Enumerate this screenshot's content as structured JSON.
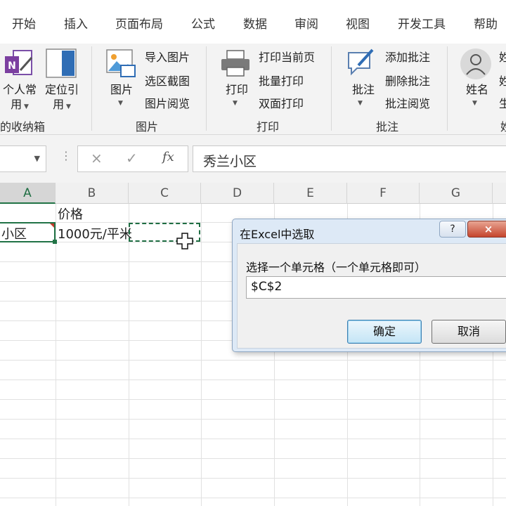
{
  "menu_tabs": [
    "开始",
    "插入",
    "页面布局",
    "公式",
    "数据",
    "审阅",
    "视图",
    "开发工具",
    "帮助"
  ],
  "ribbon": {
    "favorites": {
      "btn1_line1": "个人常",
      "btn1_line2": "用",
      "btn2_line1": "定位引",
      "btn2_line2": "用",
      "group_label": "的收纳箱"
    },
    "picture": {
      "big": "图片",
      "items": [
        "导入图片",
        "选区截图",
        "图片阅览"
      ],
      "group_label": "图片"
    },
    "print": {
      "big": "打印",
      "items": [
        "打印当前页",
        "批量打印",
        "双面打印"
      ],
      "group_label": "打印"
    },
    "comment": {
      "big": "批注",
      "items": [
        "添加批注",
        "删除批注",
        "批注阅览"
      ],
      "group_label": "批注"
    },
    "name": {
      "big": "姓名",
      "partial_items": [
        "姓",
        "姓",
        "生"
      ],
      "group_label": "姓"
    }
  },
  "formula_bar": {
    "cancel": "×",
    "enter": "✓",
    "fx": "fx",
    "content": "秀兰小区"
  },
  "columns": [
    "A",
    "B",
    "C",
    "D",
    "E",
    "F",
    "G"
  ],
  "cells": {
    "b1": "价格",
    "a2": "小区",
    "b2": "1000元/平米"
  },
  "dialog": {
    "title": "在Excel中选取",
    "help": "?",
    "close": "×",
    "prompt": "选择一个单元格（一个单元格即可）",
    "value": "$C$2",
    "ok": "确定",
    "cancel": "取消"
  },
  "colors": {
    "accent_green": "#217346",
    "dialog_frame": "#dde9f6",
    "close_red": "#c5452d"
  }
}
